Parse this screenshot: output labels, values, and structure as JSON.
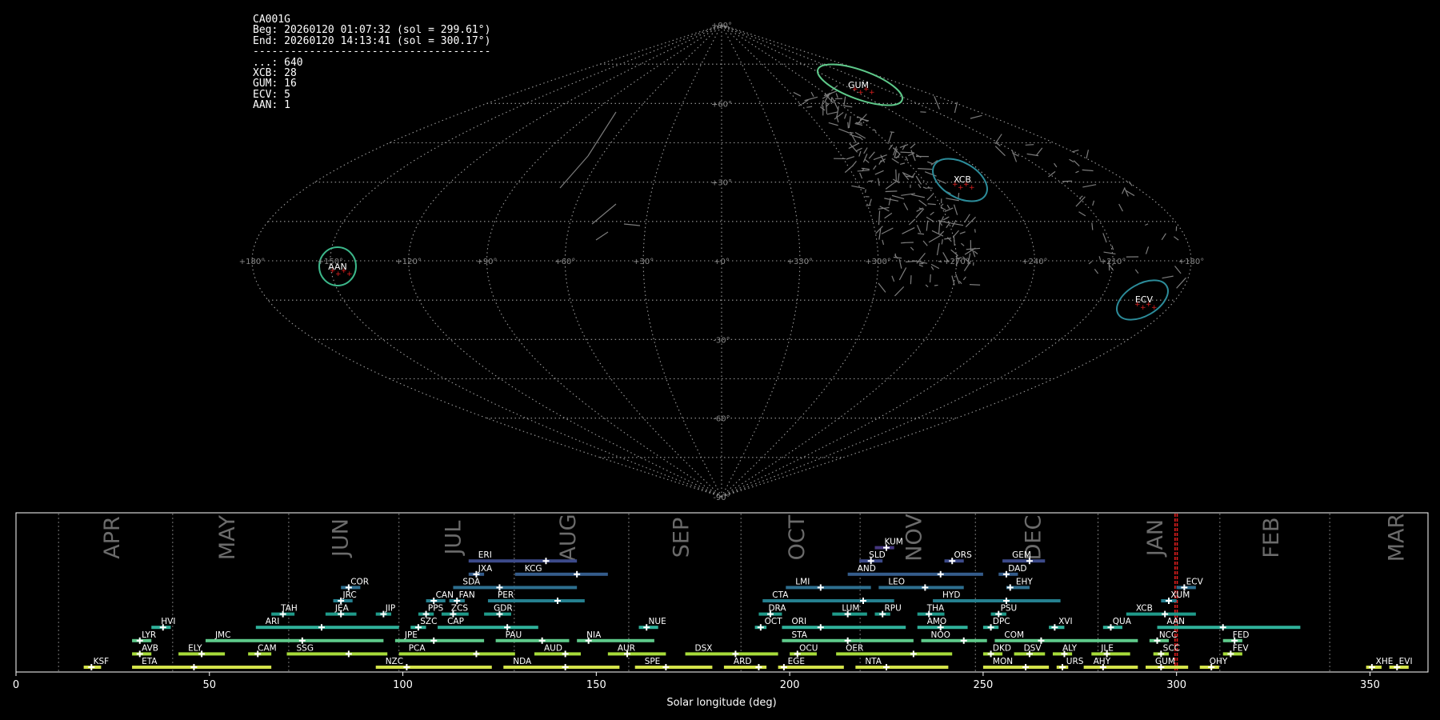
{
  "header": {
    "lines": [
      "CA001G",
      "Beg: 20260120 01:07:32 (sol = 299.61°)",
      "End: 20260120 14:13:41 (sol = 300.17°)",
      "--------------------------------------",
      "...: 640",
      "XCB: 28",
      "GUM: 16",
      "ECV: 5",
      "AAN: 1"
    ]
  },
  "sky_map": {
    "projection": "sinusoidal",
    "lon_labels": [
      "+180°",
      "+150°",
      "+120°",
      "+90°",
      "+60°",
      "+30°",
      "+0°",
      "+330°",
      "+300°",
      "+270°",
      "+240°",
      "+210°",
      "+180°"
    ],
    "lat_labels": [
      "+90°",
      "+60°",
      "+30°",
      "-30°",
      "-60°",
      "-90°"
    ],
    "lat_values": [
      90,
      60,
      30,
      -30,
      -60,
      -90
    ],
    "radiants": [
      {
        "code": "GUM",
        "lon": 232,
        "lat": 63,
        "color": "#5ec98a"
      },
      {
        "code": "XCB",
        "lon": 252,
        "lat": 27,
        "color": "#2c8c9a"
      },
      {
        "code": "AAN",
        "lon": 153,
        "lat": -3,
        "color": "#3cb78a"
      },
      {
        "code": "ECV",
        "lon": 200,
        "lat": -24,
        "color": "#2c8c9a"
      }
    ]
  },
  "chart_data": {
    "type": "timeline",
    "xlabel": "Solar longitude (deg)",
    "xlim": [
      0,
      365
    ],
    "xticks": [
      0,
      50,
      100,
      150,
      200,
      250,
      300,
      350
    ],
    "months": [
      {
        "name": "APR",
        "start": 11.0
      },
      {
        "name": "MAY",
        "start": 40.5
      },
      {
        "name": "JUN",
        "start": 70.5
      },
      {
        "name": "JUL",
        "start": 99.0
      },
      {
        "name": "AUG",
        "start": 128.8
      },
      {
        "name": "SEP",
        "start": 158.4
      },
      {
        "name": "OCT",
        "start": 187.4
      },
      {
        "name": "NOV",
        "start": 218.2
      },
      {
        "name": "DEC",
        "start": 248.0
      },
      {
        "name": "JAN",
        "start": 279.7
      },
      {
        "name": "FEB",
        "start": 311.2
      },
      {
        "name": "MAR",
        "start": 339.6
      }
    ],
    "current_sol": [
      299.61,
      300.17
    ],
    "showers": [
      {
        "code": "KSF",
        "row": 0,
        "start": 17.5,
        "end": 22,
        "peak": 19.5,
        "color": "#d4e34a"
      },
      {
        "code": "ETA",
        "row": 0,
        "start": 30,
        "end": 66,
        "peak": 46,
        "color": "#d4e34a"
      },
      {
        "code": "NZC",
        "row": 0,
        "start": 93,
        "end": 123,
        "peak": 101,
        "color": "#d4e34a"
      },
      {
        "code": "NDA",
        "row": 0,
        "start": 126,
        "end": 156,
        "peak": 142,
        "color": "#d4e34a"
      },
      {
        "code": "SPE",
        "row": 0,
        "start": 160,
        "end": 180,
        "peak": 168,
        "color": "#d4e34a"
      },
      {
        "code": "ARD",
        "row": 0,
        "start": 183,
        "end": 194,
        "peak": 192,
        "color": "#d4e34a"
      },
      {
        "code": "EGE",
        "row": 0,
        "start": 197,
        "end": 214,
        "peak": 198.5,
        "color": "#d4e34a"
      },
      {
        "code": "NTA",
        "row": 0,
        "start": 217,
        "end": 241,
        "peak": 225,
        "color": "#d4e34a"
      },
      {
        "code": "MON",
        "row": 0,
        "start": 250,
        "end": 267,
        "peak": 261,
        "color": "#d4e34a"
      },
      {
        "code": "URS",
        "row": 0,
        "start": 269,
        "end": 272,
        "peak": 270.5,
        "color": "#d4e34a"
      },
      {
        "code": "AHY",
        "row": 0,
        "start": 276,
        "end": 290,
        "peak": 281,
        "color": "#d4e34a"
      },
      {
        "code": "GUM",
        "row": 0,
        "start": 292,
        "end": 303,
        "peak": 296,
        "color": "#d4e34a"
      },
      {
        "code": "OHY",
        "row": 0,
        "start": 306,
        "end": 311,
        "peak": 309,
        "color": "#d4e34a"
      },
      {
        "code": "XHE",
        "row": 0,
        "start": 349,
        "end": 353,
        "peak": 350.5,
        "color": "#d4e34a"
      },
      {
        "code": "EVI",
        "row": 0,
        "start": 355,
        "end": 360,
        "peak": 357,
        "color": "#d4e34a"
      },
      {
        "code": "AVB",
        "row": 1,
        "start": 30,
        "end": 35,
        "peak": 32,
        "color": "#a7db3a"
      },
      {
        "code": "ELY",
        "row": 1,
        "start": 42,
        "end": 54,
        "peak": 48,
        "color": "#a7db3a"
      },
      {
        "code": "CAM",
        "row": 1,
        "start": 60,
        "end": 66,
        "peak": 62.5,
        "color": "#a7db3a"
      },
      {
        "code": "SSG",
        "row": 1,
        "start": 70,
        "end": 96,
        "peak": 86,
        "color": "#a7db3a"
      },
      {
        "code": "PCA",
        "row": 1,
        "start": 99,
        "end": 129,
        "peak": 119,
        "color": "#a7db3a"
      },
      {
        "code": "AUD",
        "row": 1,
        "start": 134,
        "end": 146,
        "peak": 142,
        "color": "#a7db3a"
      },
      {
        "code": "AUR",
        "row": 1,
        "start": 153,
        "end": 168,
        "peak": 158,
        "color": "#a7db3a"
      },
      {
        "code": "DSX",
        "row": 1,
        "start": 173,
        "end": 197,
        "peak": 186,
        "color": "#a7db3a"
      },
      {
        "code": "OCU",
        "row": 1,
        "start": 200,
        "end": 207,
        "peak": 202,
        "color": "#a7db3a"
      },
      {
        "code": "OER",
        "row": 1,
        "start": 212,
        "end": 242,
        "peak": 232,
        "color": "#a7db3a"
      },
      {
        "code": "DKD",
        "row": 1,
        "start": 250,
        "end": 255,
        "peak": 252,
        "color": "#a7db3a"
      },
      {
        "code": "DSV",
        "row": 1,
        "start": 258,
        "end": 266,
        "peak": 262,
        "color": "#a7db3a"
      },
      {
        "code": "ALY",
        "row": 1,
        "start": 268,
        "end": 273,
        "peak": 271,
        "color": "#a7db3a"
      },
      {
        "code": "JLE",
        "row": 1,
        "start": 278,
        "end": 288,
        "peak": 282,
        "color": "#a7db3a"
      },
      {
        "code": "SCC",
        "row": 1,
        "start": 294,
        "end": 298,
        "peak": 296,
        "color": "#a7db3a"
      },
      {
        "code": "FEV",
        "row": 1,
        "start": 312,
        "end": 317,
        "peak": 314,
        "color": "#a7db3a"
      },
      {
        "code": "LYR",
        "row": 2,
        "start": 30,
        "end": 35,
        "peak": 32,
        "color": "#5ec98a"
      },
      {
        "code": "JMC",
        "row": 2,
        "start": 49,
        "end": 95,
        "peak": 74,
        "color": "#5ec98a"
      },
      {
        "code": "JPE",
        "row": 2,
        "start": 98,
        "end": 121,
        "peak": 108,
        "color": "#5ec98a"
      },
      {
        "code": "PAU",
        "row": 2,
        "start": 124,
        "end": 143,
        "peak": 136,
        "color": "#5ec98a"
      },
      {
        "code": "NIA",
        "row": 2,
        "start": 145,
        "end": 165,
        "peak": 148,
        "color": "#5ec98a"
      },
      {
        "code": "STA",
        "row": 2,
        "start": 198,
        "end": 232,
        "peak": 215,
        "color": "#5ec98a"
      },
      {
        "code": "NOO",
        "row": 2,
        "start": 234,
        "end": 251,
        "peak": 245,
        "color": "#5ec98a"
      },
      {
        "code": "COM",
        "row": 2,
        "start": 253,
        "end": 290,
        "peak": 265,
        "color": "#5ec98a"
      },
      {
        "code": "NCC",
        "row": 2,
        "start": 293,
        "end": 298,
        "peak": 295,
        "color": "#5ec98a"
      },
      {
        "code": "FED",
        "row": 2,
        "start": 312,
        "end": 317,
        "peak": 315,
        "color": "#5ec98a"
      },
      {
        "code": "HVI",
        "row": 3,
        "start": 35,
        "end": 40,
        "peak": 38,
        "color": "#2fb19a"
      },
      {
        "code": "ARI",
        "row": 3,
        "start": 62,
        "end": 99,
        "peak": 79,
        "color": "#2fb19a"
      },
      {
        "code": "SZC",
        "row": 3,
        "start": 102,
        "end": 106,
        "peak": 104,
        "color": "#2fb19a"
      },
      {
        "code": "CAP",
        "row": 3,
        "start": 109,
        "end": 135,
        "peak": 127,
        "color": "#2fb19a"
      },
      {
        "code": "NUE",
        "row": 3,
        "start": 161,
        "end": 166,
        "peak": 163,
        "color": "#2fb19a"
      },
      {
        "code": "OCT",
        "row": 3,
        "start": 191,
        "end": 194,
        "peak": 192.5,
        "color": "#2fb19a"
      },
      {
        "code": "ORI",
        "row": 3,
        "start": 198,
        "end": 230,
        "peak": 208,
        "color": "#2fb19a"
      },
      {
        "code": "AMO",
        "row": 3,
        "start": 233,
        "end": 246,
        "peak": 239,
        "color": "#2fb19a"
      },
      {
        "code": "DPC",
        "row": 3,
        "start": 250,
        "end": 254,
        "peak": 252,
        "color": "#2fb19a"
      },
      {
        "code": "XVI",
        "row": 3,
        "start": 267,
        "end": 271,
        "peak": 268.5,
        "color": "#2fb19a"
      },
      {
        "code": "QUA",
        "row": 3,
        "start": 281,
        "end": 286,
        "peak": 283,
        "color": "#2fb19a"
      },
      {
        "code": "AAN",
        "row": 3,
        "start": 295,
        "end": 332,
        "peak": 312,
        "color": "#2fb19a"
      },
      {
        "code": "TAH",
        "row": 4,
        "start": 66,
        "end": 72,
        "peak": 69,
        "color": "#1f9a8a"
      },
      {
        "code": "JEA",
        "row": 4,
        "start": 80,
        "end": 88,
        "peak": 84,
        "color": "#1f9a8a"
      },
      {
        "code": "JIP",
        "row": 4,
        "start": 93,
        "end": 97,
        "peak": 95,
        "color": "#1f9a8a"
      },
      {
        "code": "PPS",
        "row": 4,
        "start": 104,
        "end": 108,
        "peak": 106,
        "color": "#1f9a8a"
      },
      {
        "code": "ZCS",
        "row": 4,
        "start": 110,
        "end": 117,
        "peak": 113,
        "color": "#1f9a8a"
      },
      {
        "code": "GDR",
        "row": 4,
        "start": 121,
        "end": 128,
        "peak": 125,
        "color": "#1f9a8a"
      },
      {
        "code": "DRA",
        "row": 4,
        "start": 192,
        "end": 198,
        "peak": 195,
        "color": "#1f9a8a"
      },
      {
        "code": "LUM",
        "row": 4,
        "start": 211,
        "end": 220,
        "peak": 215,
        "color": "#1f9a8a"
      },
      {
        "code": "RPU",
        "row": 4,
        "start": 222,
        "end": 226,
        "peak": 224,
        "color": "#1f9a8a"
      },
      {
        "code": "THA",
        "row": 4,
        "start": 233,
        "end": 240,
        "peak": 236,
        "color": "#1f9a8a"
      },
      {
        "code": "PSU",
        "row": 4,
        "start": 252,
        "end": 256,
        "peak": 254,
        "color": "#1f9a8a"
      },
      {
        "code": "XCB",
        "row": 4,
        "start": 287,
        "end": 305,
        "peak": 297,
        "color": "#1f9a8a"
      },
      {
        "code": "JRC",
        "row": 5,
        "start": 82,
        "end": 87,
        "peak": 84,
        "color": "#25808f"
      },
      {
        "code": "CAN",
        "row": 5,
        "start": 106,
        "end": 111,
        "peak": 108,
        "color": "#25808f"
      },
      {
        "code": "FAN",
        "row": 5,
        "start": 112,
        "end": 116,
        "peak": 114,
        "color": "#25808f"
      },
      {
        "code": "PER",
        "row": 5,
        "start": 122,
        "end": 147,
        "peak": 140,
        "color": "#25808f"
      },
      {
        "code": "CTA",
        "row": 5,
        "start": 193,
        "end": 227,
        "peak": 219,
        "color": "#25808f"
      },
      {
        "code": "HYD",
        "row": 5,
        "start": 237,
        "end": 270,
        "peak": 256,
        "color": "#25808f"
      },
      {
        "code": "XUM",
        "row": 5,
        "start": 296,
        "end": 300,
        "peak": 298,
        "color": "#25808f"
      },
      {
        "code": "COR",
        "row": 6,
        "start": 84,
        "end": 89,
        "peak": 86,
        "color": "#2d6f8f"
      },
      {
        "code": "SDA",
        "row": 6,
        "start": 113,
        "end": 145,
        "peak": 125,
        "color": "#2d6f8f"
      },
      {
        "code": "LMI",
        "row": 6,
        "start": 199,
        "end": 221,
        "peak": 208,
        "color": "#2d6f8f"
      },
      {
        "code": "LEO",
        "row": 6,
        "start": 223,
        "end": 245,
        "peak": 235,
        "color": "#2d6f8f"
      },
      {
        "code": "EHY",
        "row": 6,
        "start": 256,
        "end": 262,
        "peak": 257,
        "color": "#2d6f8f"
      },
      {
        "code": "ECV",
        "row": 6,
        "start": 300,
        "end": 305,
        "peak": 302,
        "color": "#2d6f8f"
      },
      {
        "code": "JXA",
        "row": 7,
        "start": 117,
        "end": 121,
        "peak": 119,
        "color": "#345c8c"
      },
      {
        "code": "KCG",
        "row": 7,
        "start": 129,
        "end": 153,
        "peak": 145,
        "color": "#345c8c"
      },
      {
        "code": "AND",
        "row": 7,
        "start": 215,
        "end": 250,
        "peak": 239,
        "color": "#345c8c"
      },
      {
        "code": "DAD",
        "row": 7,
        "start": 254,
        "end": 259,
        "peak": 256,
        "color": "#345c8c"
      },
      {
        "code": "ERI",
        "row": 8,
        "start": 117,
        "end": 145,
        "peak": 137,
        "color": "#3c4a8a"
      },
      {
        "code": "SLD",
        "row": 8,
        "start": 218,
        "end": 224,
        "peak": 221,
        "color": "#3c4a8a"
      },
      {
        "code": "ORS",
        "row": 8,
        "start": 240,
        "end": 245,
        "peak": 242,
        "color": "#3c4a8a"
      },
      {
        "code": "GEM",
        "row": 8,
        "start": 255,
        "end": 266,
        "peak": 262,
        "color": "#3c4a8a"
      },
      {
        "code": "KUM",
        "row": 9,
        "start": 222,
        "end": 227,
        "peak": 225,
        "color": "#453780"
      }
    ]
  }
}
